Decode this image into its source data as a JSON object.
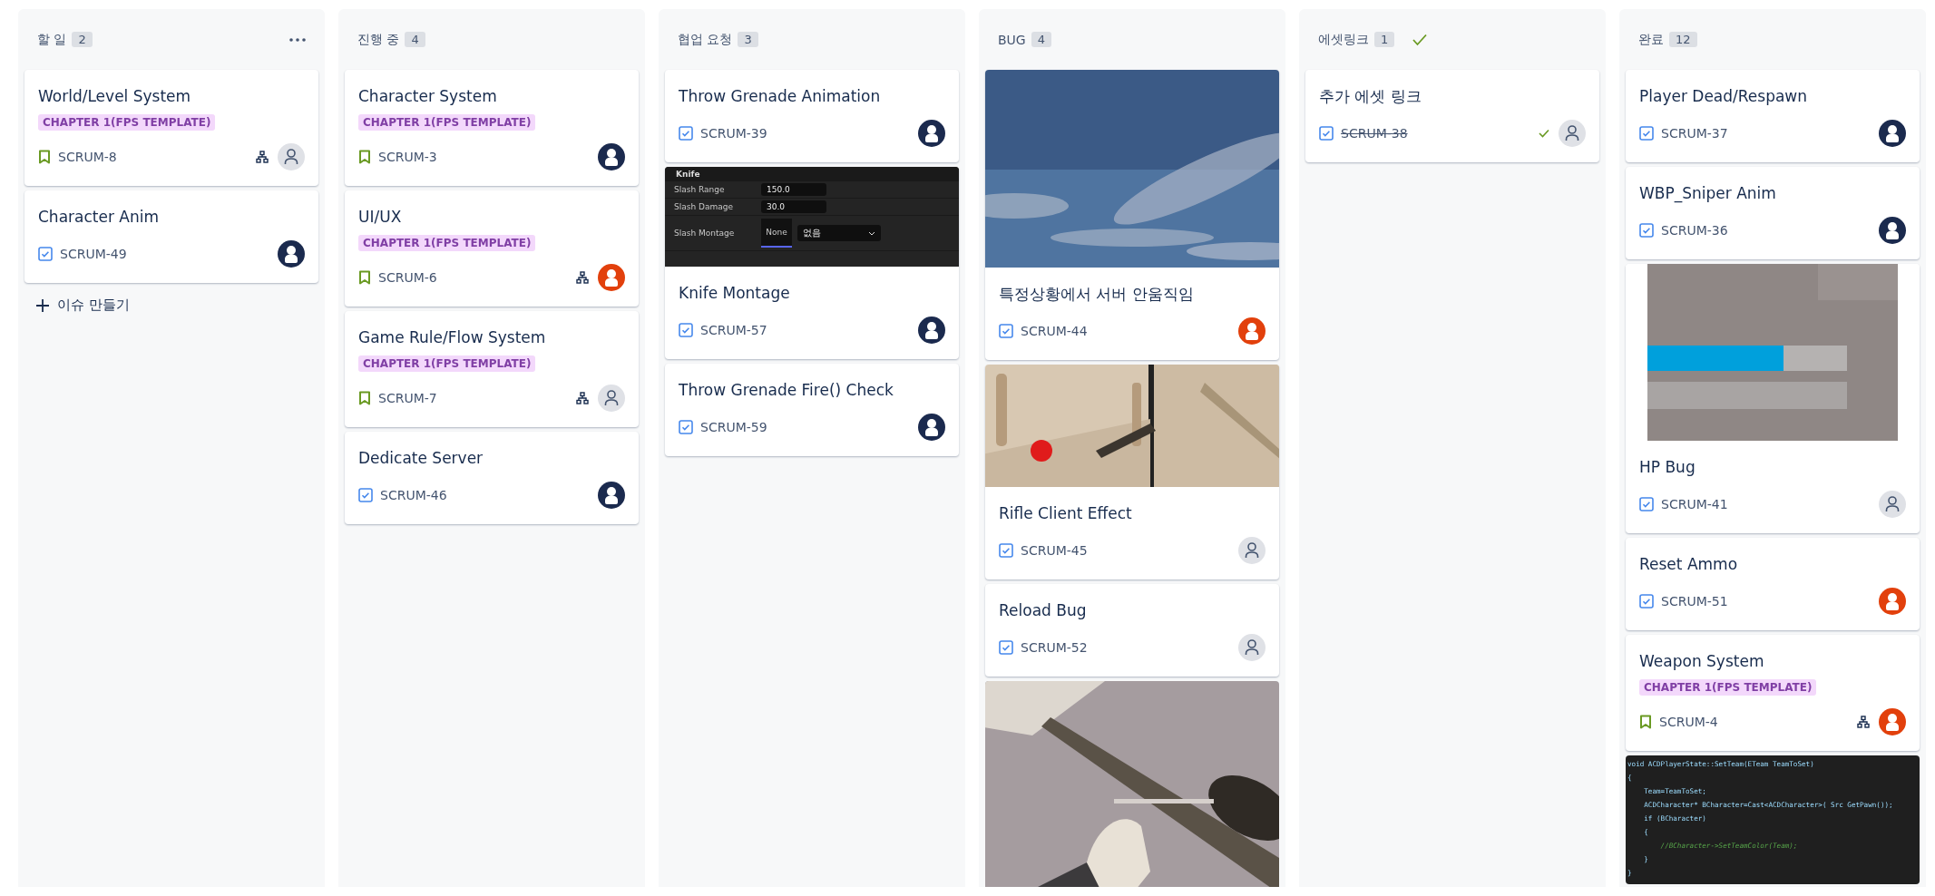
{
  "columns": [
    {
      "title": "할 일",
      "count": "2",
      "menu_button": true,
      "done_check": false,
      "create_button": "이슈 만들기",
      "cards": [
        {
          "title": "World/Level System",
          "label": "CHAPTER 1(FPS TEMPLATE)",
          "kind": "story",
          "key": "SCRUM-8",
          "done": false,
          "subtasks": true,
          "avatar": {
            "kind": "empty"
          }
        },
        {
          "title": "Character Anim",
          "kind": "task",
          "key": "SCRUM-49",
          "done": false,
          "subtasks": false,
          "avatar": {
            "kind": "user",
            "color": "#1b2a4e"
          }
        }
      ]
    },
    {
      "title": "진행 중",
      "count": "4",
      "menu_button": false,
      "done_check": false,
      "cards": [
        {
          "title": "Character System",
          "label": "CHAPTER 1(FPS TEMPLATE)",
          "kind": "story",
          "key": "SCRUM-3",
          "done": false,
          "subtasks": false,
          "avatar": {
            "kind": "user",
            "color": "#1b2a4e"
          }
        },
        {
          "title": "UI/UX",
          "label": "CHAPTER 1(FPS TEMPLATE)",
          "kind": "story",
          "key": "SCRUM-6",
          "done": false,
          "subtasks": true,
          "avatar": {
            "kind": "user",
            "color": "#e2400c"
          }
        },
        {
          "title": "Game Rule/Flow System",
          "label": "CHAPTER 1(FPS TEMPLATE)",
          "kind": "story",
          "key": "SCRUM-7",
          "done": false,
          "subtasks": true,
          "avatar": {
            "kind": "empty"
          }
        },
        {
          "title": "Dedicate Server",
          "kind": "task",
          "key": "SCRUM-46",
          "done": false,
          "subtasks": false,
          "avatar": {
            "kind": "user",
            "color": "#1b2a4e"
          }
        }
      ]
    },
    {
      "title": "협업 요청",
      "count": "3",
      "menu_button": false,
      "done_check": false,
      "cards": [
        {
          "title": "Throw Grenade Animation",
          "kind": "task",
          "key": "SCRUM-39",
          "done": false,
          "subtasks": false,
          "avatar": {
            "kind": "user",
            "color": "#1b2a4e"
          }
        },
        {
          "attachment": {
            "kind": "editor",
            "section": "Knife",
            "rows": [
              {
                "label": "Slash Range",
                "value": "150.0"
              },
              {
                "label": "Slash Damage",
                "value": "30.0"
              },
              {
                "label": "Slash Montage",
                "thumb": "None",
                "select": "없음"
              }
            ]
          },
          "title": "Knife Montage",
          "kind": "task",
          "key": "SCRUM-57",
          "done": false,
          "subtasks": false,
          "avatar": {
            "kind": "user",
            "color": "#1b2a4e"
          }
        },
        {
          "title": "Throw Grenade Fire() Check",
          "kind": "task",
          "key": "SCRUM-59",
          "done": false,
          "subtasks": false,
          "avatar": {
            "kind": "user",
            "color": "#1b2a4e"
          }
        }
      ]
    },
    {
      "title": "BUG",
      "count": "4",
      "menu_button": false,
      "done_check": false,
      "cards": [
        {
          "attachment": {
            "kind": "picture"
          },
          "title": "특정상황에서 서버 안움직임",
          "kind": "task",
          "key": "SCRUM-44",
          "done": false,
          "subtasks": false,
          "avatar": {
            "kind": "user",
            "color": "#e2400c"
          }
        },
        {
          "attachment": {
            "kind": "picture"
          },
          "title": "Rifle Client Effect",
          "kind": "task",
          "key": "SCRUM-45",
          "done": false,
          "subtasks": false,
          "avatar": {
            "kind": "empty"
          }
        },
        {
          "title": "Reload Bug",
          "kind": "task",
          "key": "SCRUM-52",
          "done": false,
          "subtasks": false,
          "avatar": {
            "kind": "empty"
          }
        },
        {
          "attachment": {
            "kind": "picture"
          }
        }
      ]
    },
    {
      "title": "에셋링크",
      "count": "1",
      "menu_button": false,
      "done_check": true,
      "cards": [
        {
          "title": "추가 에셋 링크",
          "kind": "task",
          "key": "SCRUM-38",
          "done": true,
          "subtasks": false,
          "avatar": {
            "kind": "empty"
          }
        }
      ]
    },
    {
      "title": "완료",
      "count": "12",
      "menu_button": false,
      "done_check": false,
      "cards": [
        {
          "title": "Player Dead/Respawn",
          "kind": "task",
          "key": "SCRUM-37",
          "done": false,
          "subtasks": false,
          "avatar": {
            "kind": "user",
            "color": "#1b2a4e"
          }
        },
        {
          "title": "WBP_Sniper Anim",
          "kind": "task",
          "key": "SCRUM-36",
          "done": false,
          "subtasks": false,
          "avatar": {
            "kind": "user",
            "color": "#1b2a4e"
          }
        },
        {
          "attachment": {
            "kind": "picture"
          },
          "title": "HP Bug",
          "kind": "task",
          "key": "SCRUM-41",
          "done": false,
          "subtasks": false,
          "avatar": {
            "kind": "empty"
          }
        },
        {
          "title": "Reset Ammo",
          "kind": "task",
          "key": "SCRUM-51",
          "done": false,
          "subtasks": false,
          "avatar": {
            "kind": "user",
            "color": "#e2400c"
          }
        },
        {
          "title": "Weapon System",
          "label": "CHAPTER 1(FPS TEMPLATE)",
          "kind": "story",
          "key": "SCRUM-4",
          "done": false,
          "subtasks": true,
          "avatar": {
            "kind": "user",
            "color": "#e2400c"
          }
        },
        {
          "attachment": {
            "kind": "code",
            "lines": [
              {
                "kind": "code",
                "text": "void ACDPlayerState::SetTeam(ETeam TeamToSet)"
              },
              {
                "kind": "code",
                "text": "{"
              },
              {
                "kind": "code",
                "text": "    Team=TeamToSet;"
              },
              {
                "kind": "code",
                "text": "    ACDCharacter* BCharacter=Cast<ACDCharacter>( Src GetPawn());"
              },
              {
                "kind": "code",
                "text": "    if (BCharacter)"
              },
              {
                "kind": "code",
                "text": "    {"
              },
              {
                "kind": "comment",
                "text": "        //BCharacter->SetTeamColor(Team);"
              },
              {
                "kind": "code",
                "text": "    }"
              },
              {
                "kind": "code",
                "text": "}"
              }
            ]
          }
        }
      ]
    }
  ]
}
